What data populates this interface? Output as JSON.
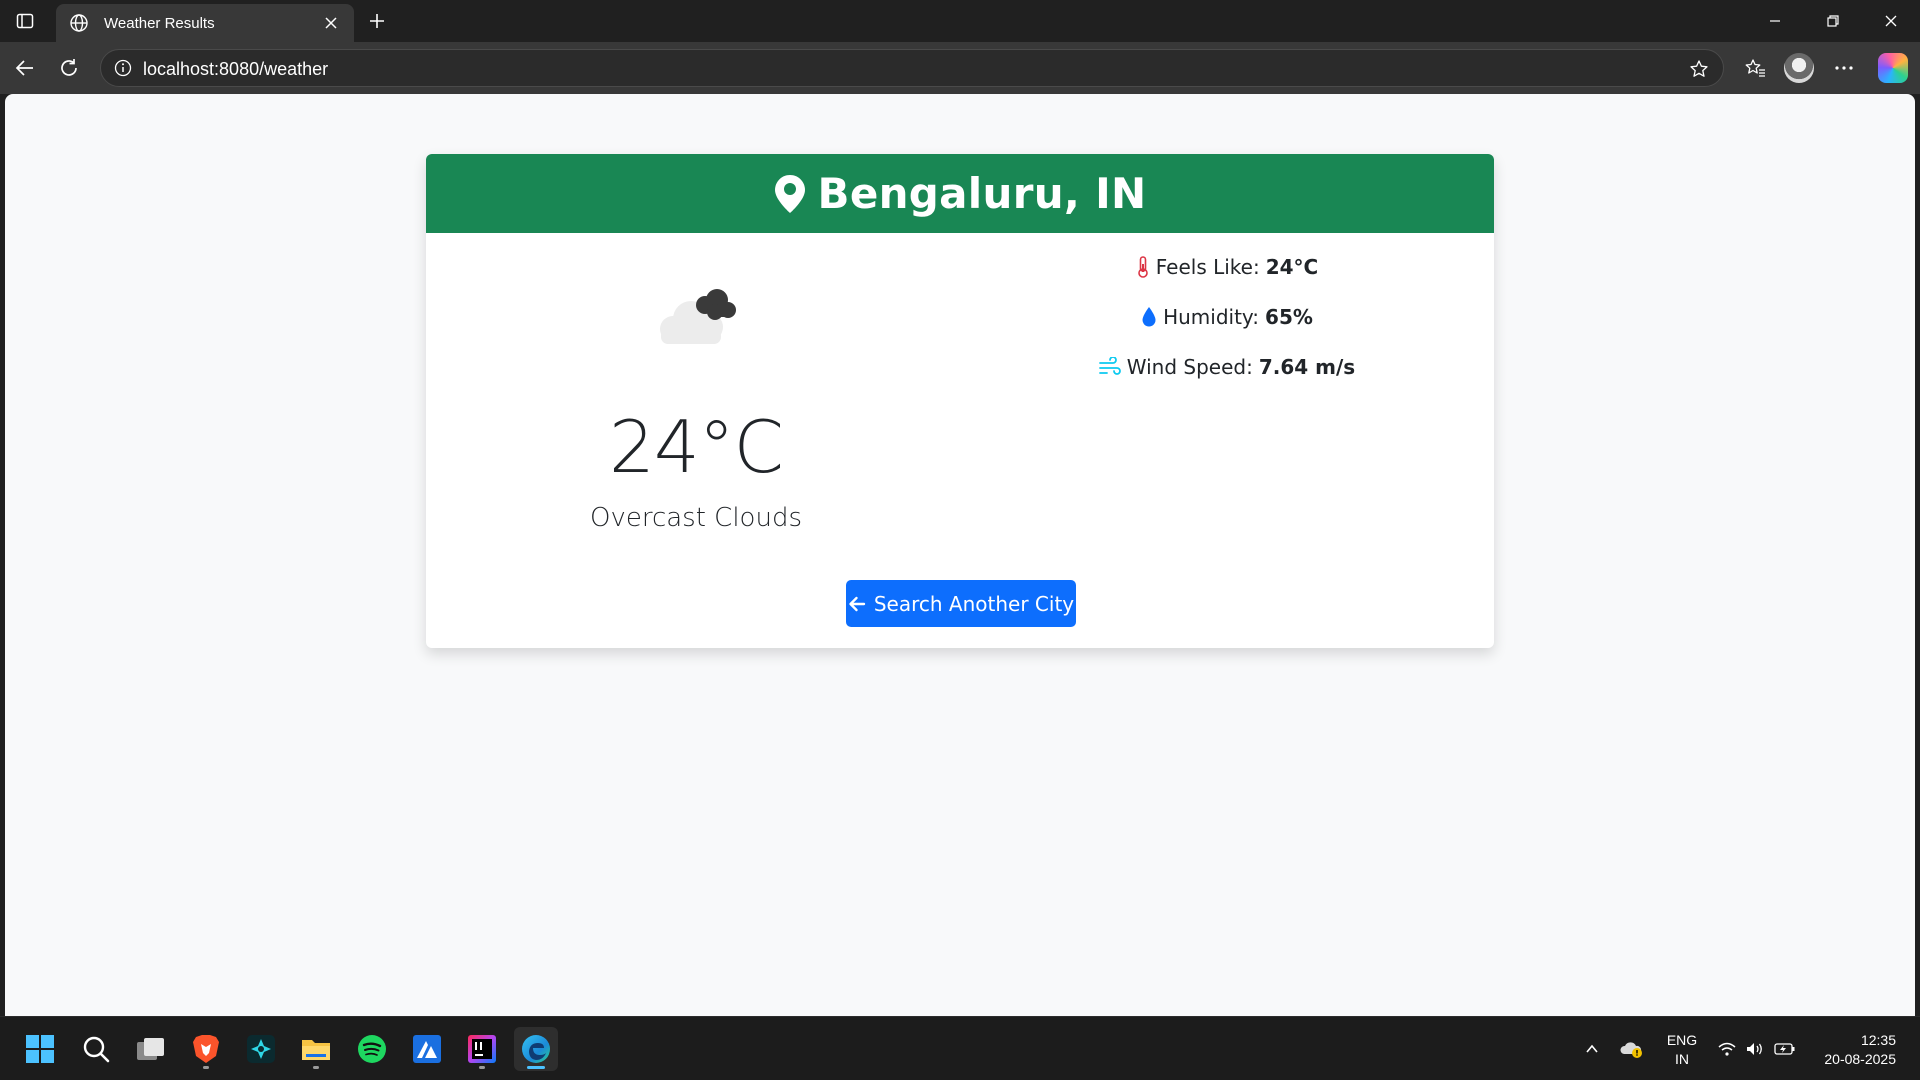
{
  "browser": {
    "tab_title": "Weather Results",
    "url": "localhost:8080/weather"
  },
  "page": {
    "city": "Bengaluru, IN",
    "temperature": "24°C",
    "condition": "Overcast Clouds",
    "feels_like_label": "Feels Like:",
    "feels_like_value": "24°C",
    "humidity_label": "Humidity:",
    "humidity_value": "65%",
    "wind_label": "Wind Speed:",
    "wind_value": "7.64 m/s",
    "back_button_label": "Search Another City"
  },
  "colors": {
    "header_green": "#198754",
    "button_blue": "#0d6efd",
    "thermometer_red": "#dc3545",
    "humidity_blue": "#0d6efd",
    "wind_cyan": "#0dcaf0"
  },
  "taskbar": {
    "apps": [
      "start-icon",
      "search-icon",
      "task-view-icon",
      "brave-icon",
      "app-icon",
      "file-explorer-icon",
      "spotify-icon",
      "app-icon",
      "intellij-icon",
      "edge-icon"
    ],
    "lang_line1": "ENG",
    "lang_line2": "IN",
    "time": "12:35",
    "date": "20-08-2025"
  }
}
